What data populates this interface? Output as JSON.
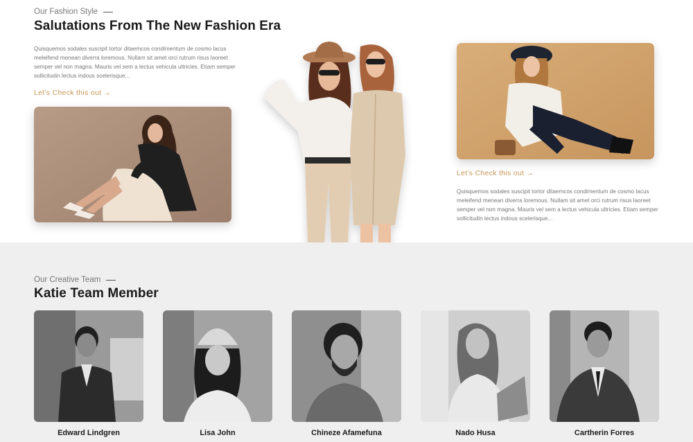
{
  "fashion": {
    "eyebrow": "Our Fashion Style",
    "title": "Salutations From The New Fashion Era",
    "paragraph_left": "Quisquemos sodales suscipit tortor ditaemcos condimentum de cosmo lacus meleifend menean diverra loremous. Nullam sit amet orci rutrum risus laoreet semper vel non magna. Mauris vel sem a lectus vehicula ultricies. Etiam semper sollicitudin lectus indous scelerisque...",
    "cta_left": "Let's Check this out →",
    "cta_right": "Let's Check this out →",
    "paragraph_right": "Quisquemos sodales suscipit tortor ditaemcos condimentum de cosmo lacus meleifend menean diverra loremous. Nullam sit amet orci rutrum risus laoreet semper vel non magna. Mauris vel sem a lectus vehicula ultricies. Etiam semper sollicitudin lectus indous scelerisque..."
  },
  "team": {
    "eyebrow": "Our Creative Team",
    "title": "Katie Team Member",
    "members": [
      {
        "name": "Edward Lindgren"
      },
      {
        "name": "Lisa John"
      },
      {
        "name": "Chineze Afamefuna"
      },
      {
        "name": "Nado Husa"
      },
      {
        "name": "Cartherin Forres"
      }
    ]
  },
  "colors": {
    "accent": "#c79556",
    "heading": "#1a1a1a",
    "body_text": "#777777",
    "team_background": "#efefef"
  }
}
